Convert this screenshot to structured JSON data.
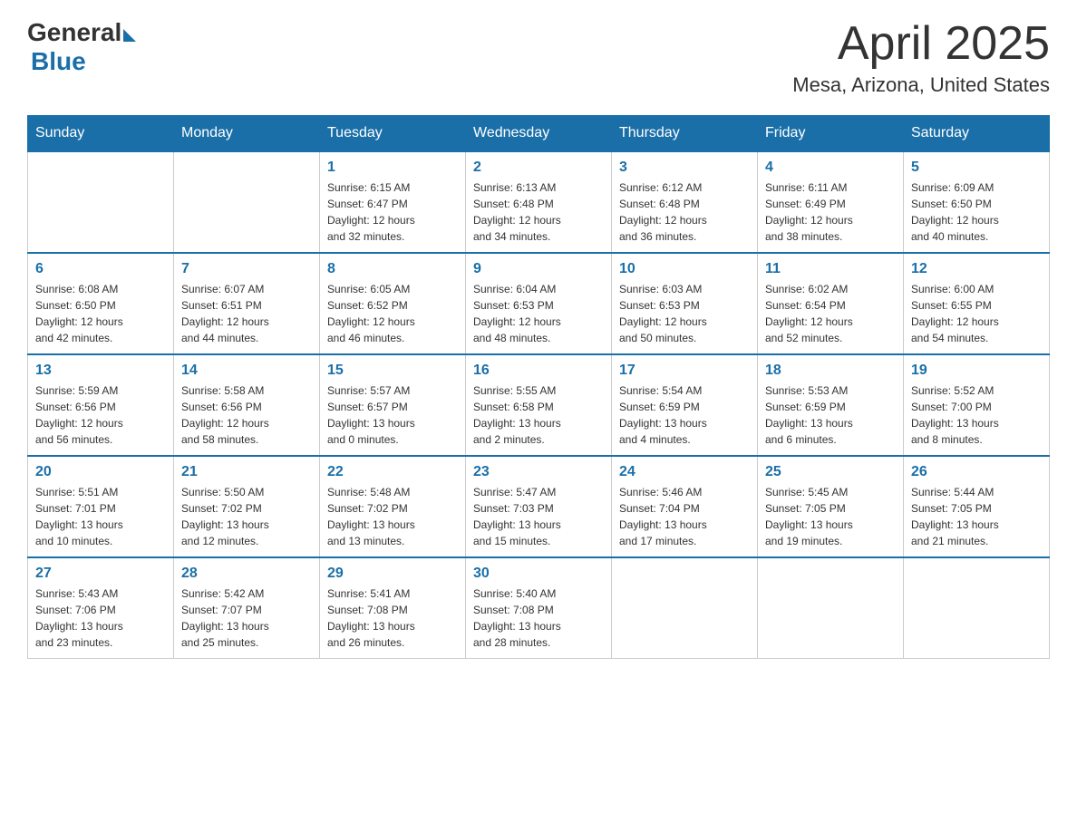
{
  "header": {
    "logo_general": "General",
    "logo_blue": "Blue",
    "month_title": "April 2025",
    "location": "Mesa, Arizona, United States"
  },
  "days_of_week": [
    "Sunday",
    "Monday",
    "Tuesday",
    "Wednesday",
    "Thursday",
    "Friday",
    "Saturday"
  ],
  "weeks": [
    [
      {
        "day": "",
        "info": ""
      },
      {
        "day": "",
        "info": ""
      },
      {
        "day": "1",
        "info": "Sunrise: 6:15 AM\nSunset: 6:47 PM\nDaylight: 12 hours\nand 32 minutes."
      },
      {
        "day": "2",
        "info": "Sunrise: 6:13 AM\nSunset: 6:48 PM\nDaylight: 12 hours\nand 34 minutes."
      },
      {
        "day": "3",
        "info": "Sunrise: 6:12 AM\nSunset: 6:48 PM\nDaylight: 12 hours\nand 36 minutes."
      },
      {
        "day": "4",
        "info": "Sunrise: 6:11 AM\nSunset: 6:49 PM\nDaylight: 12 hours\nand 38 minutes."
      },
      {
        "day": "5",
        "info": "Sunrise: 6:09 AM\nSunset: 6:50 PM\nDaylight: 12 hours\nand 40 minutes."
      }
    ],
    [
      {
        "day": "6",
        "info": "Sunrise: 6:08 AM\nSunset: 6:50 PM\nDaylight: 12 hours\nand 42 minutes."
      },
      {
        "day": "7",
        "info": "Sunrise: 6:07 AM\nSunset: 6:51 PM\nDaylight: 12 hours\nand 44 minutes."
      },
      {
        "day": "8",
        "info": "Sunrise: 6:05 AM\nSunset: 6:52 PM\nDaylight: 12 hours\nand 46 minutes."
      },
      {
        "day": "9",
        "info": "Sunrise: 6:04 AM\nSunset: 6:53 PM\nDaylight: 12 hours\nand 48 minutes."
      },
      {
        "day": "10",
        "info": "Sunrise: 6:03 AM\nSunset: 6:53 PM\nDaylight: 12 hours\nand 50 minutes."
      },
      {
        "day": "11",
        "info": "Sunrise: 6:02 AM\nSunset: 6:54 PM\nDaylight: 12 hours\nand 52 minutes."
      },
      {
        "day": "12",
        "info": "Sunrise: 6:00 AM\nSunset: 6:55 PM\nDaylight: 12 hours\nand 54 minutes."
      }
    ],
    [
      {
        "day": "13",
        "info": "Sunrise: 5:59 AM\nSunset: 6:56 PM\nDaylight: 12 hours\nand 56 minutes."
      },
      {
        "day": "14",
        "info": "Sunrise: 5:58 AM\nSunset: 6:56 PM\nDaylight: 12 hours\nand 58 minutes."
      },
      {
        "day": "15",
        "info": "Sunrise: 5:57 AM\nSunset: 6:57 PM\nDaylight: 13 hours\nand 0 minutes."
      },
      {
        "day": "16",
        "info": "Sunrise: 5:55 AM\nSunset: 6:58 PM\nDaylight: 13 hours\nand 2 minutes."
      },
      {
        "day": "17",
        "info": "Sunrise: 5:54 AM\nSunset: 6:59 PM\nDaylight: 13 hours\nand 4 minutes."
      },
      {
        "day": "18",
        "info": "Sunrise: 5:53 AM\nSunset: 6:59 PM\nDaylight: 13 hours\nand 6 minutes."
      },
      {
        "day": "19",
        "info": "Sunrise: 5:52 AM\nSunset: 7:00 PM\nDaylight: 13 hours\nand 8 minutes."
      }
    ],
    [
      {
        "day": "20",
        "info": "Sunrise: 5:51 AM\nSunset: 7:01 PM\nDaylight: 13 hours\nand 10 minutes."
      },
      {
        "day": "21",
        "info": "Sunrise: 5:50 AM\nSunset: 7:02 PM\nDaylight: 13 hours\nand 12 minutes."
      },
      {
        "day": "22",
        "info": "Sunrise: 5:48 AM\nSunset: 7:02 PM\nDaylight: 13 hours\nand 13 minutes."
      },
      {
        "day": "23",
        "info": "Sunrise: 5:47 AM\nSunset: 7:03 PM\nDaylight: 13 hours\nand 15 minutes."
      },
      {
        "day": "24",
        "info": "Sunrise: 5:46 AM\nSunset: 7:04 PM\nDaylight: 13 hours\nand 17 minutes."
      },
      {
        "day": "25",
        "info": "Sunrise: 5:45 AM\nSunset: 7:05 PM\nDaylight: 13 hours\nand 19 minutes."
      },
      {
        "day": "26",
        "info": "Sunrise: 5:44 AM\nSunset: 7:05 PM\nDaylight: 13 hours\nand 21 minutes."
      }
    ],
    [
      {
        "day": "27",
        "info": "Sunrise: 5:43 AM\nSunset: 7:06 PM\nDaylight: 13 hours\nand 23 minutes."
      },
      {
        "day": "28",
        "info": "Sunrise: 5:42 AM\nSunset: 7:07 PM\nDaylight: 13 hours\nand 25 minutes."
      },
      {
        "day": "29",
        "info": "Sunrise: 5:41 AM\nSunset: 7:08 PM\nDaylight: 13 hours\nand 26 minutes."
      },
      {
        "day": "30",
        "info": "Sunrise: 5:40 AM\nSunset: 7:08 PM\nDaylight: 13 hours\nand 28 minutes."
      },
      {
        "day": "",
        "info": ""
      },
      {
        "day": "",
        "info": ""
      },
      {
        "day": "",
        "info": ""
      }
    ]
  ]
}
